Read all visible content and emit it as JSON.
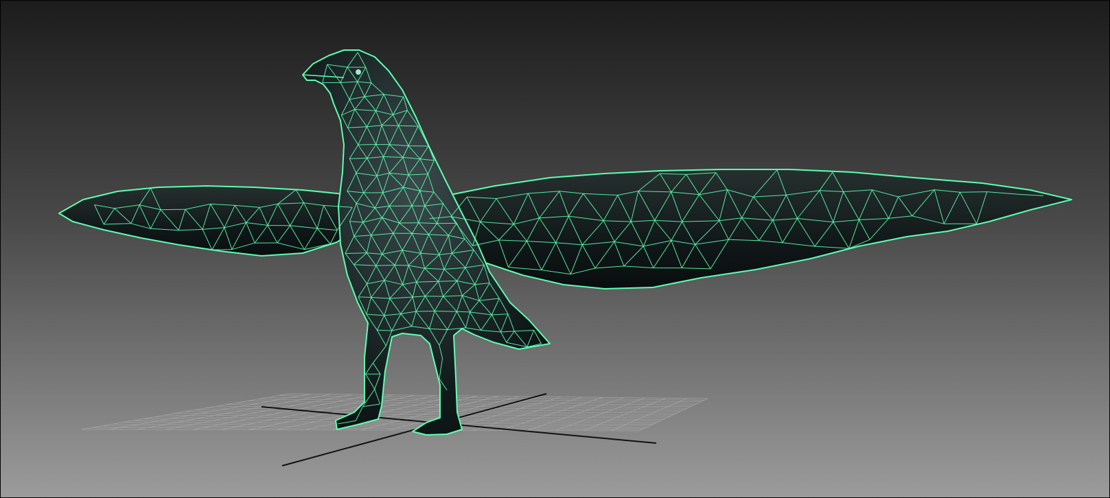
{
  "viewport": {
    "background_top": "#1c1c1c",
    "background_bottom": "#9c9c9c",
    "shading_mode": "wireframe-on-shaded"
  },
  "model": {
    "name": "crow",
    "wire_color": "#5dffb2",
    "surface_color": "#11191a",
    "surface_highlight": "#3b4a4c"
  },
  "grid": {
    "line_color": "#b0b0b0",
    "axis_color": "#111111"
  }
}
